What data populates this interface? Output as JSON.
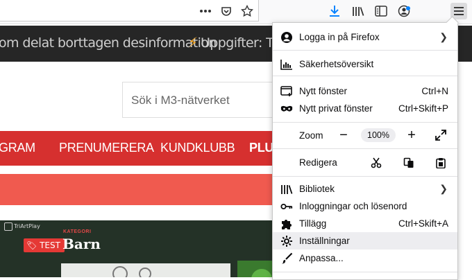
{
  "browser": {
    "url_actions": [
      "more-actions",
      "pocket",
      "bookmark-star"
    ],
    "toolbar_icons": [
      "download",
      "library",
      "sidebar",
      "account",
      "menu"
    ]
  },
  "page": {
    "ticker_text_1": "om delat borttagen desinformation",
    "ticker_text_2": "Uppgifter: Trec",
    "search_placeholder": "Sök i M3-nätverket",
    "nav": [
      "GRAM",
      "PRENUMERERA",
      "KUNDKLUBB",
      "PLUS"
    ],
    "hero": {
      "brand": "TriArtPlay",
      "category": "KATEGORI",
      "tag": "TEST",
      "title": "Barn"
    }
  },
  "menu": {
    "sign_in": "Logga in på Firefox",
    "security": "Säkerhetsöversikt",
    "new_window": "Nytt fönster",
    "new_window_shortcut": "Ctrl+N",
    "private_window": "Nytt privat fönster",
    "private_window_shortcut": "Ctrl+Skift+P",
    "zoom_label": "Zoom",
    "zoom_minus": "−",
    "zoom_value": "100%",
    "zoom_plus": "+",
    "edit_label": "Redigera",
    "library": "Bibliotek",
    "logins": "Inloggningar och lösenord",
    "addons": "Tillägg",
    "addons_shortcut": "Ctrl+Skift+A",
    "settings": "Inställningar",
    "customize": "Anpassa..."
  },
  "colors": {
    "accent_blue": "#0a84ff",
    "nav_red": "#d6302f",
    "band_red": "#f05a4f",
    "ticker_bg": "#262626"
  }
}
